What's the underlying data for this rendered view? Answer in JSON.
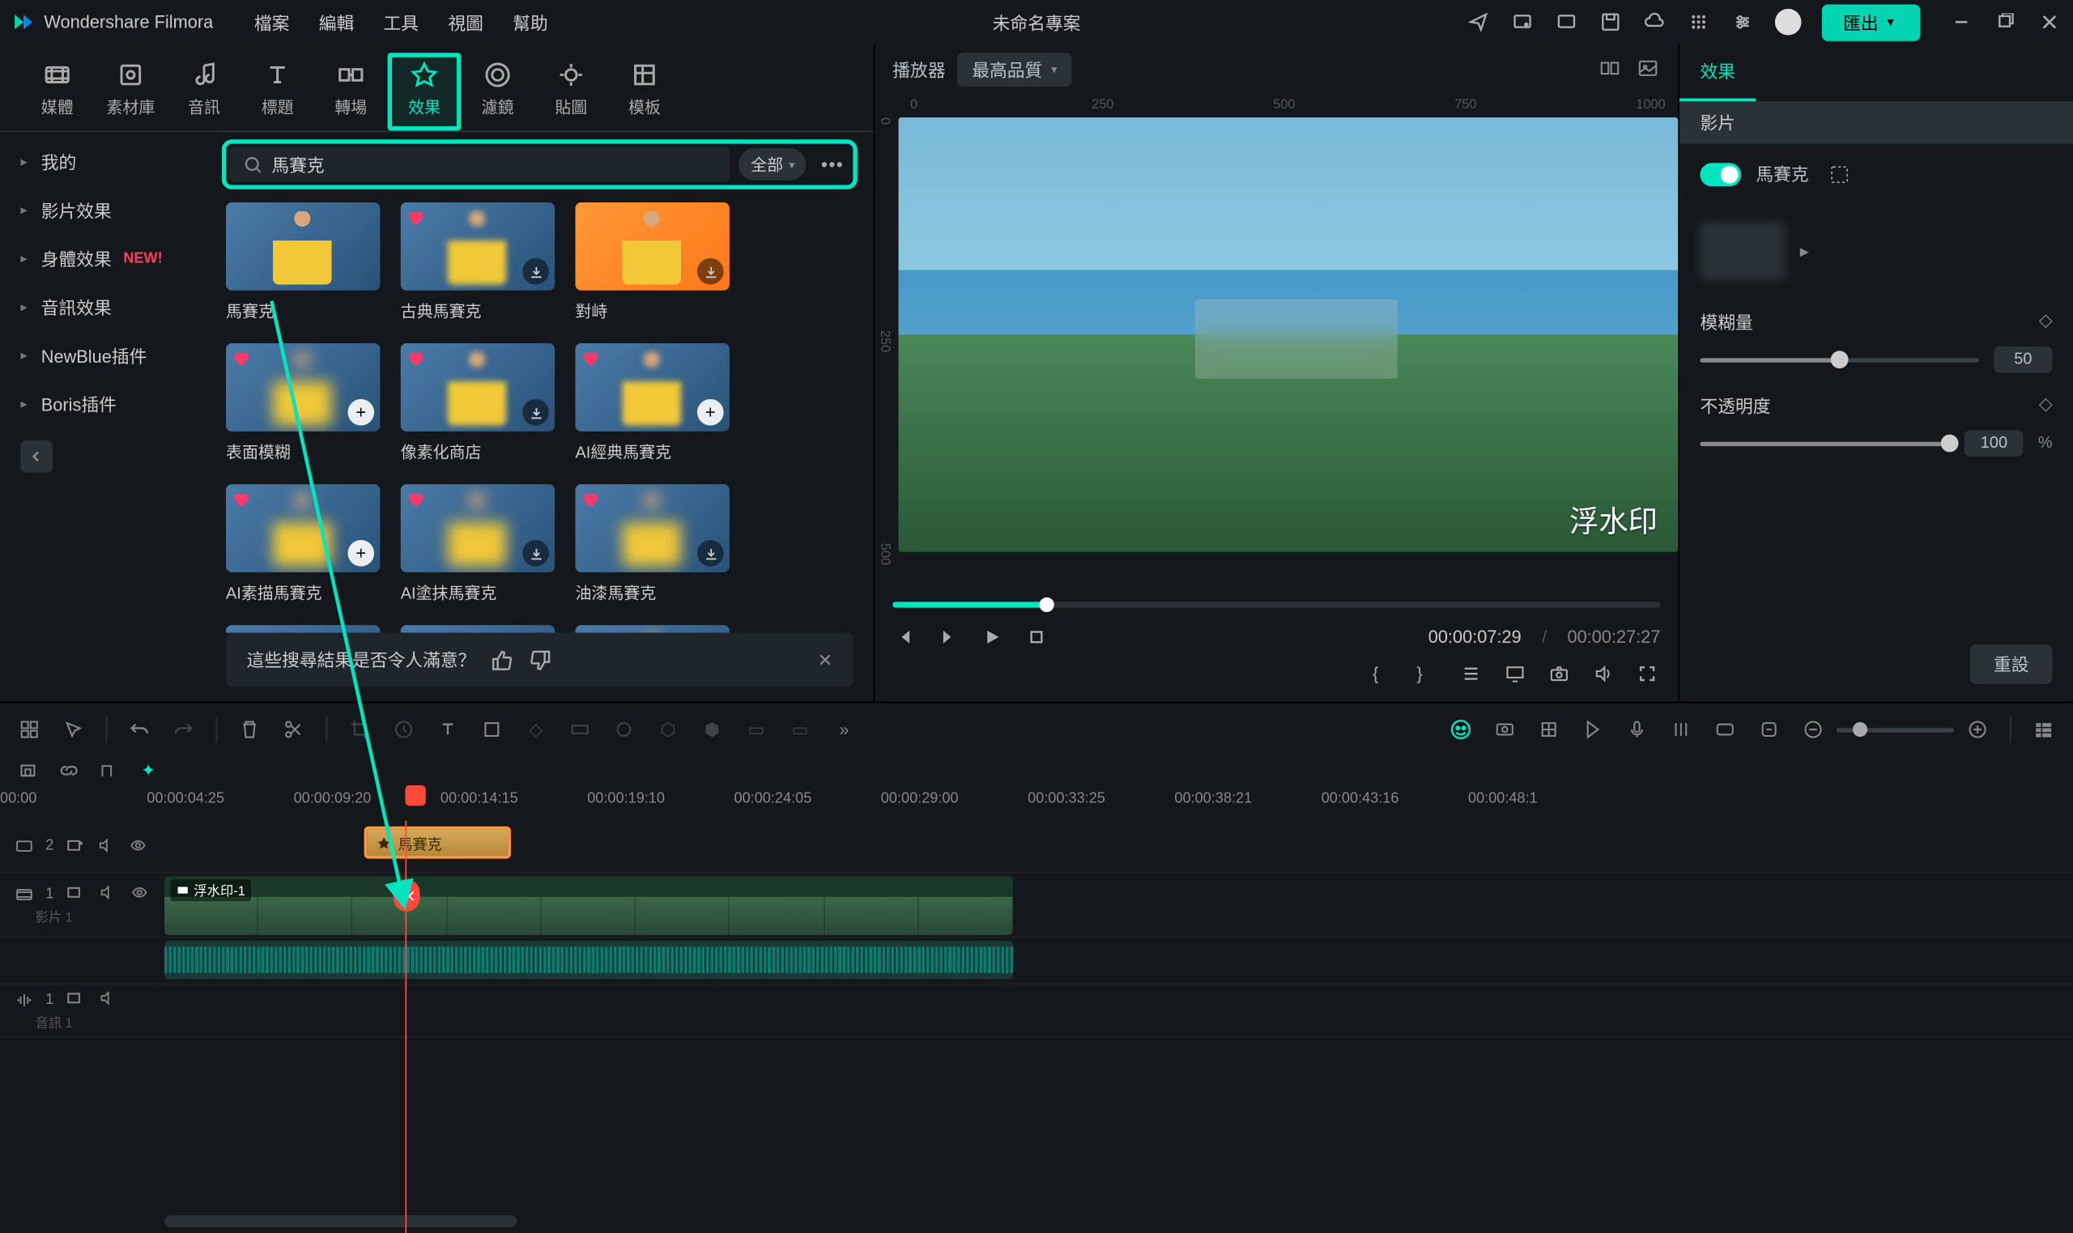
{
  "app_name": "Wondershare Filmora",
  "menus": [
    "檔案",
    "編輯",
    "工具",
    "視圖",
    "幫助"
  ],
  "project_name": "未命名專案",
  "export_label": "匯出",
  "media_tabs": [
    {
      "label": "媒體"
    },
    {
      "label": "素材庫"
    },
    {
      "label": "音訊"
    },
    {
      "label": "標題"
    },
    {
      "label": "轉場"
    },
    {
      "label": "效果",
      "active": true,
      "highlight": true
    },
    {
      "label": "濾鏡"
    },
    {
      "label": "貼圖"
    },
    {
      "label": "模板"
    }
  ],
  "sidebar": [
    {
      "label": "我的"
    },
    {
      "label": "影片效果"
    },
    {
      "label": "身體效果",
      "new": "NEW!"
    },
    {
      "label": "音訊效果"
    },
    {
      "label": "NewBlue插件"
    },
    {
      "label": "Boris插件"
    }
  ],
  "search_value": "馬賽克",
  "filter_label": "全部",
  "effects": [
    {
      "name": "馬賽克",
      "style": "",
      "heart": false,
      "dl": false
    },
    {
      "name": "古典馬賽克",
      "style": "pixel",
      "heart": true,
      "dl": true
    },
    {
      "name": "對峙",
      "style": "orange",
      "heart": false,
      "dl": true
    },
    {
      "name": "表面模糊",
      "style": "blur",
      "heart": true,
      "dl": true,
      "add": true
    },
    {
      "name": "像素化商店",
      "style": "pixel",
      "heart": true,
      "dl": true
    },
    {
      "name": "AI經典馬賽克",
      "style": "pixel",
      "heart": true,
      "dl": false,
      "add": true
    },
    {
      "name": "AI素描馬賽克",
      "style": "blur",
      "heart": true,
      "dl": false,
      "add": true
    },
    {
      "name": "AI塗抹馬賽克",
      "style": "blur",
      "heart": true,
      "dl": true
    },
    {
      "name": "油漆馬賽克",
      "style": "blur",
      "heart": true,
      "dl": true
    },
    {
      "name": "",
      "style": "",
      "heart": true,
      "dl": false
    },
    {
      "name": "",
      "style": "",
      "heart": true,
      "dl": false
    },
    {
      "name": "",
      "style": "blur",
      "heart": true,
      "dl": false
    }
  ],
  "feedback_text": "這些搜尋結果是否令人滿意？",
  "player": {
    "label": "播放器",
    "quality": "最高品質",
    "watermark": "浮水印",
    "current": "00:00:07:29",
    "duration": "00:00:27:27"
  },
  "ruler_h": [
    "0",
    "250",
    "500",
    "750",
    "1000"
  ],
  "ruler_v": [
    "0",
    "250",
    "500"
  ],
  "props": {
    "tab": "效果",
    "sub": "影片",
    "effect_name": "馬賽克",
    "blur": {
      "label": "模糊量",
      "value": "50"
    },
    "opacity": {
      "label": "不透明度",
      "value": "100",
      "unit": "%"
    },
    "reset": "重設"
  },
  "timeline": {
    "ticks": [
      "00:00",
      "00:00:04:25",
      "00:00:09:20",
      "00:00:14:15",
      "00:00:19:10",
      "00:00:24:05",
      "00:00:29:00",
      "00:00:33:25",
      "00:00:38:21",
      "00:00:43:16",
      "00:00:48:1"
    ],
    "fx_clip": "馬賽克",
    "video_clip": "浮水印-1",
    "track_fx": "2",
    "track_v": "1",
    "track_v_label": "影片 1",
    "track_a": "1",
    "track_a_label": "音訊 1"
  }
}
